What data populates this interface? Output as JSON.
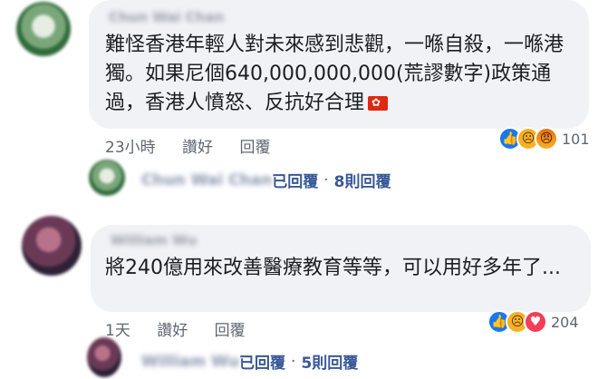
{
  "comments": [
    {
      "author": "Chun Wai Chan",
      "text": "難怪香港年輕人對未來感到悲觀，一喺自殺，一喺港獨。如果尼個640,000,000,000(荒謬數字)政策通過，香港人憤怒、反抗好合理",
      "time": "23小時",
      "like_label": "讚好",
      "reply_label": "回覆",
      "reaction_count": "101",
      "reactions": [
        "like",
        "sad",
        "angry"
      ],
      "replies_summary": {
        "author": "Chun Wai Chan",
        "replied": "已回覆",
        "separator": "·",
        "count": "8則回覆"
      }
    },
    {
      "author": "William Wu",
      "text": "將240億用來改善醫療教育等等，可以用好多年了...",
      "time": "1天",
      "like_label": "讚好",
      "reply_label": "回覆",
      "reaction_count": "204",
      "reactions": [
        "like",
        "sad",
        "love"
      ],
      "replies_summary": {
        "author": "William Wu",
        "replied": "已回覆",
        "separator": "·",
        "count": "5則回覆"
      }
    }
  ],
  "colors": {
    "bubble": "#f1f2f6",
    "link": "#385898",
    "meta": "#606770",
    "like": "#1877f2",
    "love": "#f33e58",
    "sad": "#f7b125",
    "hk_flag": "#de2910"
  },
  "icons": {
    "like": "thumbs-up-icon",
    "sad": "sad-face-icon",
    "angry": "angry-face-icon",
    "love": "heart-icon",
    "flag": "hong-kong-flag-icon"
  }
}
